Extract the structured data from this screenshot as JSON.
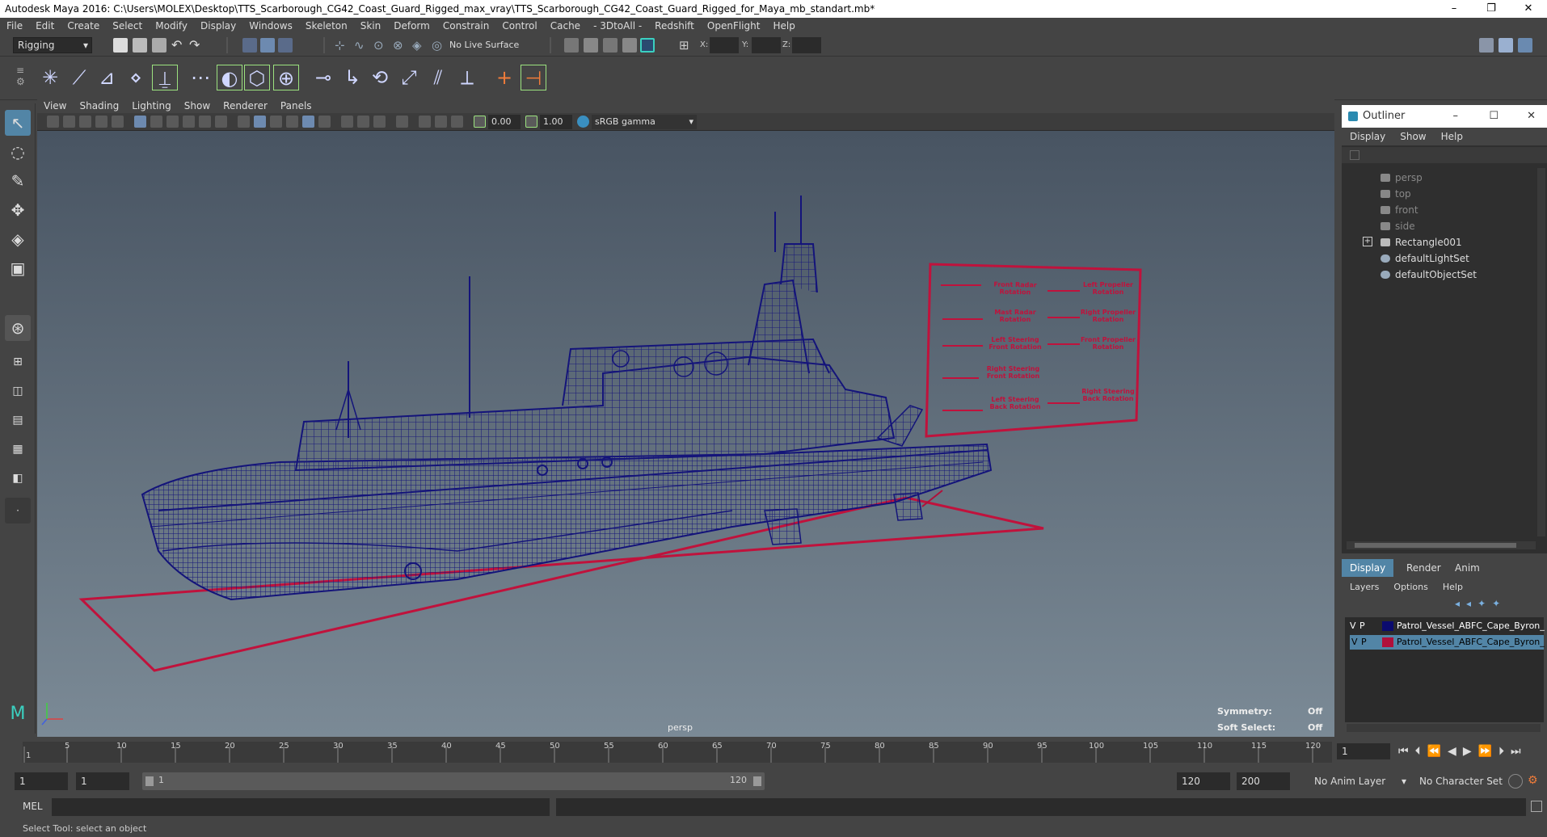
{
  "window": {
    "title": "Autodesk Maya 2016: C:\\Users\\MOLEX\\Desktop\\TTS_Scarborough_CG42_Coast_Guard_Rigged_max_vray\\TTS_Scarborough_CG42_Coast_Guard_Rigged_for_Maya_mb_standart.mb*",
    "controls": [
      "–",
      "❐",
      "✕"
    ]
  },
  "menu": [
    "File",
    "Edit",
    "Create",
    "Select",
    "Modify",
    "Display",
    "Windows",
    "Skeleton",
    "Skin",
    "Deform",
    "Constrain",
    "Control",
    "Cache",
    "- 3DtoAll -",
    "Redshift",
    "OpenFlight",
    "Help"
  ],
  "status": {
    "mode": "Rigging",
    "live_surface": "No Live Surface",
    "x_label": "X:",
    "y_label": "Y:",
    "z_label": "Z:"
  },
  "viewport": {
    "menu": [
      "View",
      "Shading",
      "Lighting",
      "Show",
      "Renderer",
      "Panels"
    ],
    "exposure": "0.00",
    "gamma": "1.00",
    "color_space": "sRGB gamma",
    "camera": "persp",
    "symmetry_label": "Symmetry:",
    "symmetry_value": "Off",
    "soft_select_label": "Soft Select:",
    "soft_select_value": "Off",
    "rig_controls": [
      {
        "label": "Front Radar Rotation"
      },
      {
        "label": "Left Propeller Rotation"
      },
      {
        "label": "Mast Radar Rotation"
      },
      {
        "label": "Right Propeller Rotation"
      },
      {
        "label": "Left Steering Front Rotation"
      },
      {
        "label": "Front Propeller Rotation"
      },
      {
        "label": "Right Steering Front Rotation"
      },
      {
        "label": "Left Steering Back Rotation"
      },
      {
        "label": "Right Steering Back Rotation"
      }
    ]
  },
  "outliner": {
    "title": "Outliner",
    "menu": [
      "Display",
      "Show",
      "Help"
    ],
    "items": [
      {
        "label": "persp",
        "dim": true
      },
      {
        "label": "top",
        "dim": true
      },
      {
        "label": "front",
        "dim": true
      },
      {
        "label": "side",
        "dim": true
      },
      {
        "label": "Rectangle001",
        "dim": false
      },
      {
        "label": "defaultLightSet",
        "dim": false
      },
      {
        "label": "defaultObjectSet",
        "dim": false
      }
    ]
  },
  "layers": {
    "tabs": [
      "Display",
      "Render",
      "Anim"
    ],
    "menu": [
      "Layers",
      "Options",
      "Help"
    ],
    "rows": [
      {
        "v": "V",
        "p": "P",
        "color": "#0b0b6e",
        "name": "Patrol_Vessel_ABFC_Cape_Byron_"
      },
      {
        "v": "V",
        "p": "P",
        "color": "#b0103a",
        "name": "Patrol_Vessel_ABFC_Cape_Byron_"
      }
    ]
  },
  "timeline": {
    "ticks": [
      "1",
      "5",
      "10",
      "15",
      "20",
      "25",
      "30",
      "35",
      "40",
      "45",
      "50",
      "55",
      "60",
      "65",
      "70",
      "75",
      "80",
      "85",
      "90",
      "95",
      "100",
      "105",
      "110",
      "115",
      "120"
    ],
    "current_frame": "1"
  },
  "range": {
    "start": "1",
    "playback_start": "1",
    "slider_start": "1",
    "slider_end": "120",
    "playback_end": "120",
    "end": "200",
    "anim_layer": "No Anim Layer",
    "character_set": "No Character Set"
  },
  "command": {
    "label": "MEL"
  },
  "help_line": "Select Tool: select an object"
}
